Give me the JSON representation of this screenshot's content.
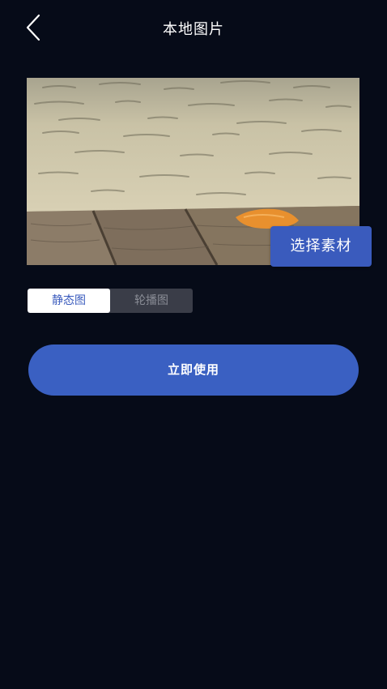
{
  "header": {
    "title": "本地图片",
    "back_icon": "chevron-left-icon"
  },
  "preview": {
    "choose_label": "选择素材"
  },
  "mode_tabs": [
    {
      "label": "静态图",
      "active": true
    },
    {
      "label": "轮播图",
      "active": false
    }
  ],
  "actions": {
    "use_label": "立即使用"
  },
  "colors": {
    "background": "#060b18",
    "accent": "#3a60c2",
    "tab_inactive_bg": "#3a3d48"
  }
}
